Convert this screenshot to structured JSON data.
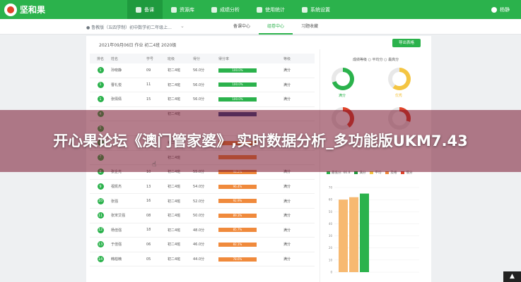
{
  "app": {
    "logo_text": "坚和果"
  },
  "nav": {
    "items": [
      {
        "label": "备课",
        "icon": "book-icon",
        "active": true
      },
      {
        "label": "资源库",
        "icon": "library-icon",
        "active": false
      },
      {
        "label": "成绩分析",
        "icon": "analysis-icon",
        "active": false
      },
      {
        "label": "使用统计",
        "icon": "stats-icon",
        "active": false
      },
      {
        "label": "系统设置",
        "icon": "gear-icon",
        "active": false
      }
    ],
    "user_name": "杨静"
  },
  "subbar": {
    "breadcrumb": "● 鲁教版（五四学制）初中数学初二年级上...",
    "arrow": "⌄",
    "tabs": [
      {
        "label": "备课中心",
        "active": false
      },
      {
        "label": "组卷中心",
        "active": true
      },
      {
        "label": "习题收藏",
        "active": false
      }
    ]
  },
  "main": {
    "header": "2021年09月06日 作业 初二4班 2020级",
    "export_label": "导出表格",
    "columns": [
      "排名",
      "姓名",
      "学号",
      "班级",
      "得分",
      "得分率",
      "等级"
    ],
    "rows": [
      {
        "rank": "1",
        "name": "孙晓静",
        "id": "09",
        "class": "初二4班",
        "score": "56.0分",
        "rate": "100.0%",
        "bar": "green",
        "level": "满分"
      },
      {
        "rank": "1",
        "name": "曹礼悦",
        "id": "11",
        "class": "初二4班",
        "score": "56.0分",
        "rate": "100.0%",
        "bar": "green",
        "level": "满分"
      },
      {
        "rank": "1",
        "name": "张倩倩",
        "id": "15",
        "class": "初二4班",
        "score": "56.0分",
        "rate": "100.0%",
        "bar": "green",
        "level": "满分"
      },
      {
        "rank": "4",
        "name": "",
        "id": "",
        "class": "初二4班",
        "score": "",
        "rate": "",
        "bar": "blue",
        "level": ""
      },
      {
        "rank": "5",
        "name": "",
        "id": "",
        "class": "",
        "score": "",
        "rate": "",
        "bar": "none",
        "level": ""
      },
      {
        "rank": "6",
        "name": "",
        "id": "17",
        "class": "初二4班",
        "score": "",
        "rate": "",
        "bar": "orange",
        "level": ""
      },
      {
        "rank": "7",
        "name": "",
        "id": "",
        "class": "初二4班",
        "score": "",
        "rate": "",
        "bar": "orange",
        "level": ""
      },
      {
        "rank": "8",
        "name": "张企光",
        "id": "10",
        "class": "初二4班",
        "score": "55.0分",
        "rate": "98.2%",
        "bar": "orange",
        "level": "满分"
      },
      {
        "rank": "9",
        "name": "视凯杰",
        "id": "13",
        "class": "初二4班",
        "score": "54.0分",
        "rate": "96.4%",
        "bar": "orange",
        "level": "满分"
      },
      {
        "rank": "10",
        "name": "张强",
        "id": "16",
        "class": "初二4班",
        "score": "52.0分",
        "rate": "92.9%",
        "bar": "orange",
        "level": "满分"
      },
      {
        "rank": "11",
        "name": "张宋艾强",
        "id": "08",
        "class": "初二4班",
        "score": "50.0分",
        "rate": "89.3%",
        "bar": "orange",
        "level": "满分"
      },
      {
        "rank": "12",
        "name": "杨佳强",
        "id": "18",
        "class": "初二4班",
        "score": "48.0分",
        "rate": "85.7%",
        "bar": "orange",
        "level": "满分"
      },
      {
        "rank": "13",
        "name": "于佳强",
        "id": "06",
        "class": "初二4班",
        "score": "46.0分",
        "rate": "82.1%",
        "bar": "orange",
        "level": "满分"
      },
      {
        "rank": "14",
        "name": "韩柏楠",
        "id": "05",
        "class": "初二4班",
        "score": "44.0分",
        "rate": "78.6%",
        "bar": "orange",
        "level": "满分"
      }
    ]
  },
  "side": {
    "title": "成绩等级 ○ 平均分  ○ 最高分",
    "donuts": [
      {
        "label": "满分",
        "color": "#2bb24c",
        "percent": 70
      },
      {
        "label": "优秀",
        "color": "#f4c542",
        "percent": 60
      },
      {
        "label": "",
        "color": "#e0452b",
        "percent": 40
      },
      {
        "label": "",
        "color": "#e0452b",
        "percent": 30
      }
    ],
    "legend": [
      {
        "label": "最低分: 66.8",
        "color": "#2bb24c"
      },
      {
        "label": "满分",
        "color": "#1f9a3e"
      },
      {
        "label": "平均",
        "color": "#f4c542"
      },
      {
        "label": "及格",
        "color": "#f08a3c"
      },
      {
        "label": "低分",
        "color": "#e0452b"
      }
    ]
  },
  "chart_data": {
    "type": "bar",
    "categories": [
      "",
      "",
      ""
    ],
    "values": [
      60,
      62,
      65
    ],
    "colors": [
      "#f7b971",
      "#f7b971",
      "#2bb24c"
    ],
    "yticks": [
      "0",
      "10",
      "20",
      "30",
      "40",
      "50",
      "60",
      "70"
    ],
    "ylim": [
      0,
      70
    ]
  },
  "banner": {
    "text": "开心果论坛《澳门管家婆》,实时数据分析_多功能版UKM7.43"
  },
  "scroll_label": "▲"
}
